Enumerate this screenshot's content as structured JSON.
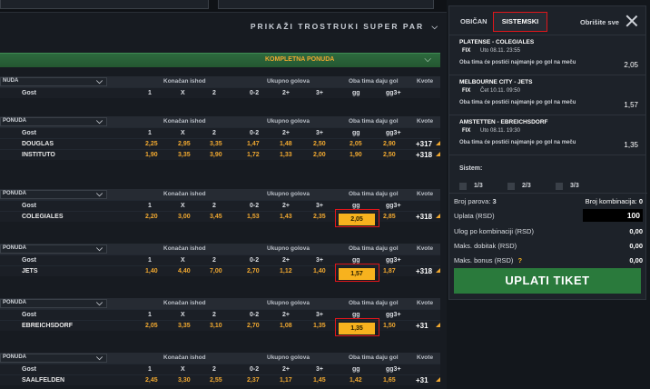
{
  "left": {
    "trostruki_label": "PRIKAŽI TROSTRUKI SUPER PAR",
    "green_bar_label": "KOMPLETNA PONUDA",
    "header_labels": {
      "select": "NUDA",
      "konacan": "Konačan ishod",
      "ukupno": "Ukupno golova",
      "oba": "Oba tima daju gol",
      "kvote": "Kvote"
    },
    "select_labels": [
      "NUDA",
      "PONUDA",
      "PONUDA",
      "PONUDA",
      "PONUDA",
      "PONUDA"
    ],
    "col_labels": [
      "1",
      "X",
      "2",
      "0-2",
      "2+",
      "3+",
      "gg",
      "gg3+"
    ],
    "blocks": [
      {
        "sub": "Gost",
        "rows": []
      },
      {
        "sub": "Gost",
        "rows": [
          {
            "name": "DOUGLAS",
            "odds": [
              "2,25",
              "2,95",
              "3,35",
              "1,47",
              "1,48",
              "2,50",
              "2,05",
              "2,90"
            ],
            "plus": "+317"
          },
          {
            "name": "INSTITUTO",
            "odds": [
              "1,90",
              "3,35",
              "3,90",
              "1,72",
              "1,33",
              "2,00",
              "1,90",
              "2,50"
            ],
            "plus": "+318"
          }
        ]
      },
      {
        "sub": "Gost",
        "rows": [
          {
            "name": "COLEGIALES",
            "odds": [
              "2,20",
              "3,00",
              "3,45",
              "1,53",
              "1,43",
              "2,35",
              "2,05",
              "2,85"
            ],
            "plus": "+318"
          }
        ]
      },
      {
        "sub": "Gost",
        "rows": [
          {
            "name": "JETS",
            "odds": [
              "1,40",
              "4,40",
              "7,00",
              "2,70",
              "1,12",
              "1,40",
              "1,57",
              "1,87"
            ],
            "plus": "+318"
          }
        ]
      },
      {
        "sub": "Gost",
        "rows": [
          {
            "name": "EBREICHSDORF",
            "odds": [
              "2,05",
              "3,35",
              "3,10",
              "2,70",
              "1,08",
              "1,35",
              "1,35",
              "1,50"
            ],
            "plus": "+31"
          }
        ]
      },
      {
        "sub": "Gost",
        "rows": [
          {
            "name": "SAALFELDEN",
            "odds": [
              "2,45",
              "3,30",
              "2,55",
              "2,37",
              "1,17",
              "1,45",
              "1,42",
              "1,65"
            ],
            "plus": "+31"
          }
        ]
      }
    ]
  },
  "slip": {
    "tab_obican": "OBIČAN",
    "tab_sistemski": "SISTEMSKI",
    "obrisi": "Obrišite sve",
    "bets": [
      {
        "match": "PLATENSE - COLEGIALES",
        "fix": "FIX",
        "date": "Uto 08.11. 23:55",
        "market": "Oba tima će postići najmanje po gol na meču",
        "odd": "2,05"
      },
      {
        "match": "MELBOURNE CITY - JETS",
        "fix": "FIX",
        "date": "Čet 10.11. 09:50",
        "market": "Oba tima će postići najmanje po gol na meču",
        "odd": "1,57"
      },
      {
        "match": "AMSTETTEN - EBREICHSDORF",
        "fix": "FIX",
        "date": "Uto 08.11. 19:30",
        "market": "Oba tima će postići najmanje po gol na meču",
        "odd": "1,35"
      }
    ],
    "sistem_label": "Sistem:",
    "sistem_opts": [
      "1/3",
      "2/3",
      "3/3"
    ],
    "broj_parova_label": "Broj parova:",
    "broj_parova": "3",
    "broj_komb_label": "Broj kombinacija:",
    "broj_komb": "0",
    "uplata_label": "Uplata (RSD)",
    "uplata_value": "100",
    "ulog_label": "Ulog po kombinaciji (RSD)",
    "ulog_value": "0,00",
    "maks_dobitak_label": "Maks. dobitak (RSD)",
    "maks_dobitak_value": "0,00",
    "maks_bonus_label": "Maks. bonus (RSD)",
    "maks_bonus_q": "?",
    "maks_bonus_value": "0,00",
    "uplati_button": "UPLATI TIKET"
  }
}
